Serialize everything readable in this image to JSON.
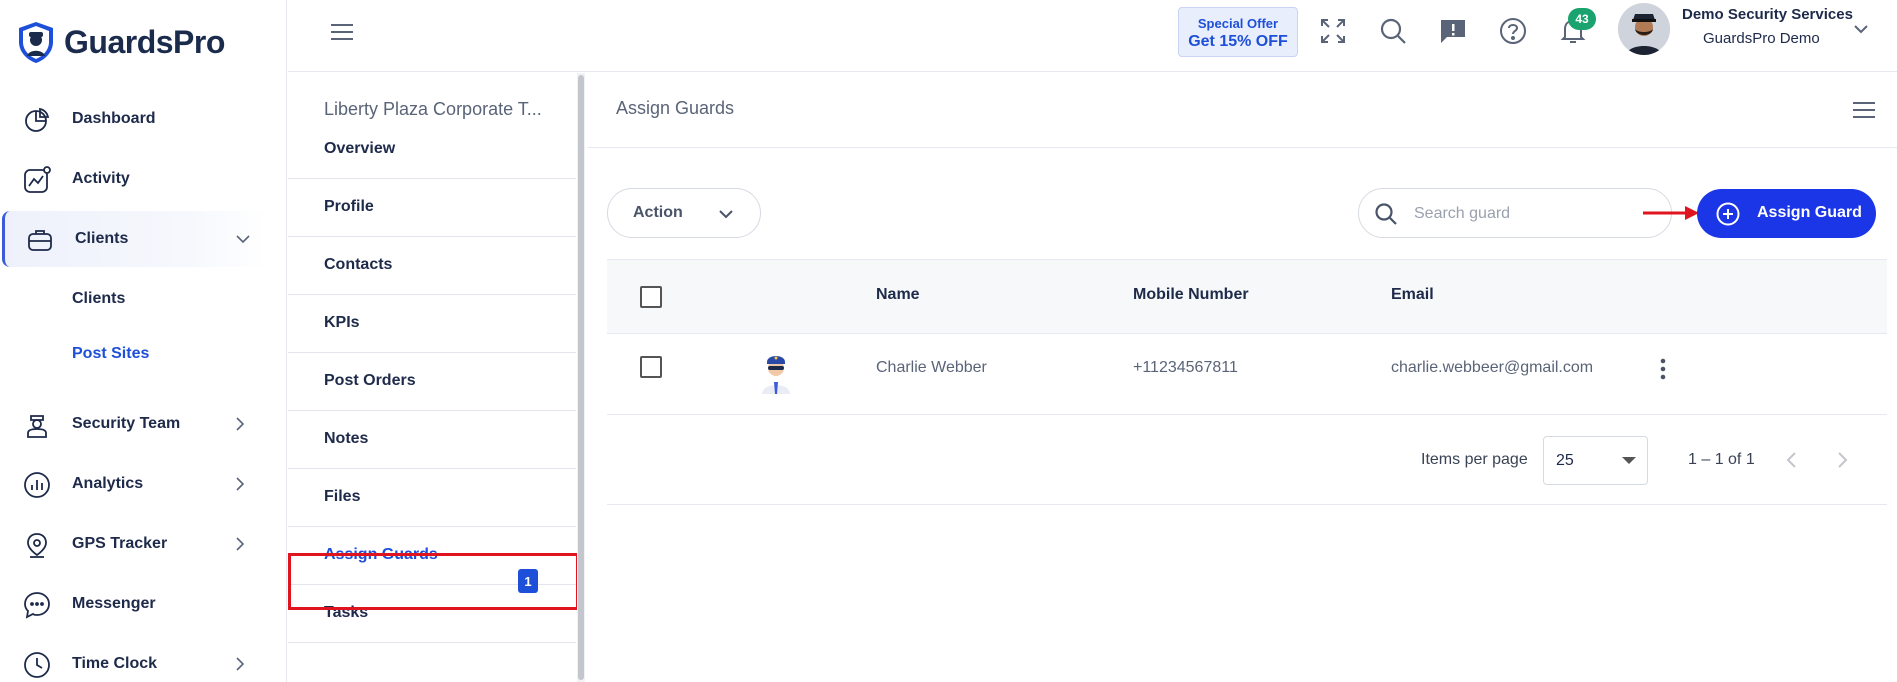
{
  "brand": {
    "name": "GuardsPro"
  },
  "sidebar": {
    "items": [
      {
        "label": "Dashboard",
        "icon": "dashboard-icon"
      },
      {
        "label": "Activity",
        "icon": "activity-icon"
      },
      {
        "label": "Clients",
        "icon": "briefcase-icon",
        "expanded": true
      },
      {
        "label": "Security Team",
        "icon": "guard-icon"
      },
      {
        "label": "Analytics",
        "icon": "analytics-icon"
      },
      {
        "label": "GPS Tracker",
        "icon": "location-pin-icon"
      },
      {
        "label": "Messenger",
        "icon": "chat-icon"
      },
      {
        "label": "Time Clock",
        "icon": "clock-icon"
      }
    ],
    "sub_items": [
      {
        "label": "Clients"
      },
      {
        "label": "Post Sites"
      }
    ]
  },
  "header": {
    "offer_line1": "Special Offer",
    "offer_line2": "Get 15% OFF",
    "notification_count": "43",
    "user_name": "Demo Security Services",
    "user_company": "GuardsPro Demo"
  },
  "subnav": {
    "title": "Liberty Plaza Corporate T...",
    "items": [
      {
        "label": "Overview"
      },
      {
        "label": "Profile"
      },
      {
        "label": "Contacts"
      },
      {
        "label": "KPIs"
      },
      {
        "label": "Post Orders"
      },
      {
        "label": "Notes"
      },
      {
        "label": "Files"
      },
      {
        "label": "Assign Guards",
        "count": "1"
      },
      {
        "label": "Tasks"
      }
    ]
  },
  "main": {
    "title": "Assign Guards",
    "action_label": "Action",
    "search_placeholder": "Search guard",
    "assign_button": "Assign Guard",
    "columns": [
      "Name",
      "Mobile Number",
      "Email"
    ],
    "rows": [
      {
        "name": "Charlie Webber",
        "mobile": "+11234567811",
        "email": "charlie.webbeer@gmail.com"
      }
    ],
    "pagination": {
      "items_per_page_label": "Items per page",
      "items_per_page": "25",
      "range": "1 – 1 of 1"
    }
  },
  "colors": {
    "accent": "#1b36e6",
    "active_text": "#1e4fd8",
    "highlight": "#e0141e",
    "badge_green": "#1aa36f"
  }
}
